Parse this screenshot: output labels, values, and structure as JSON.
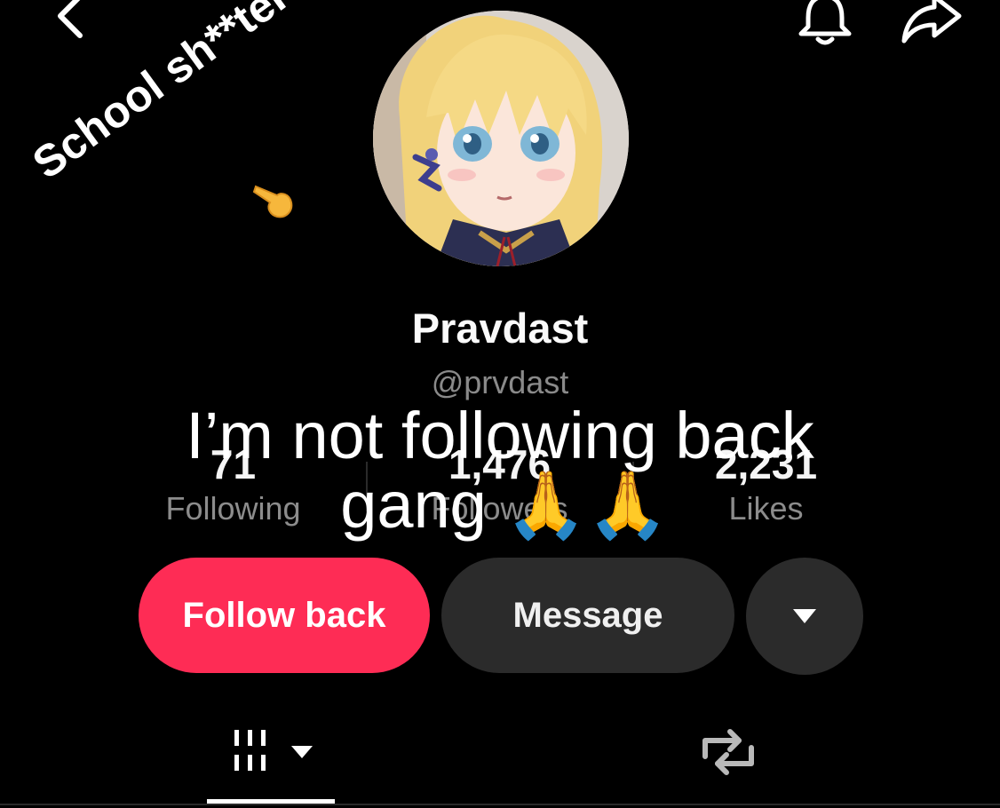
{
  "profile": {
    "display_name": "Pravdast",
    "handle": "@prvdast"
  },
  "stats": [
    {
      "value": "71",
      "label": "Following"
    },
    {
      "value": "1,476",
      "label": "Followers"
    },
    {
      "value": "2,231",
      "label": "Likes"
    }
  ],
  "actions": {
    "follow_label": "Follow back",
    "message_label": "Message"
  },
  "overlays": {
    "caption_line1": "I’m not following back",
    "caption_line2": "gang 🙏🙏",
    "diagonal_text": "School sh**ter btw"
  },
  "icons": {
    "top_left": "chevron-left-icon",
    "top_right": [
      "bell-icon",
      "share-icon"
    ],
    "tabs": [
      "grid-icon",
      "repost-icon"
    ]
  },
  "colors": {
    "accent": "#fe2c55",
    "background": "#000000",
    "secondary_button": "#2b2b2b"
  }
}
